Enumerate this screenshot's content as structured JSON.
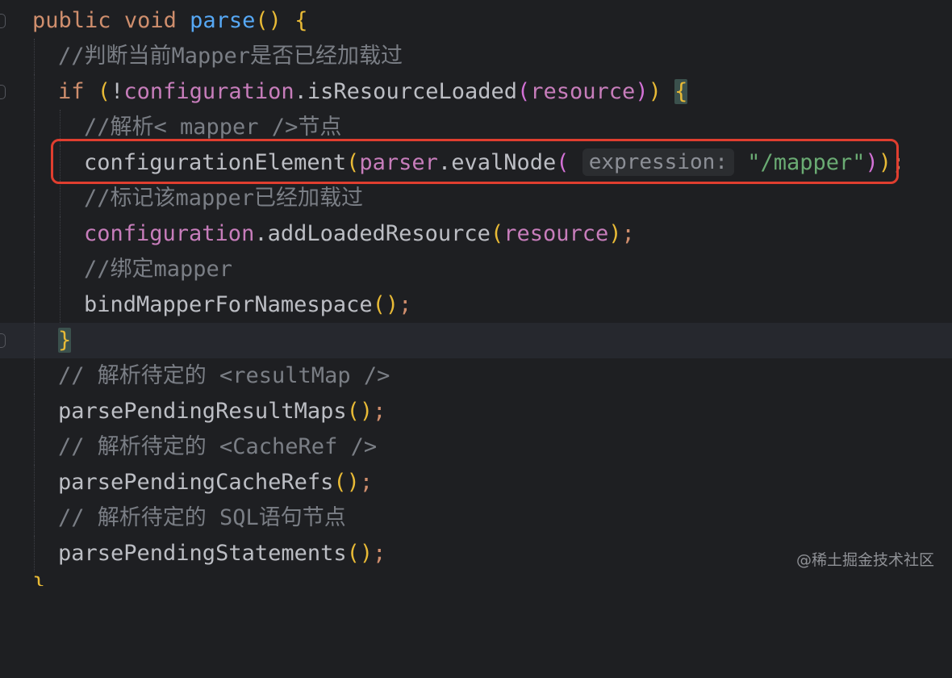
{
  "code": {
    "line1": {
      "kw1": "public",
      "kw2": "void",
      "fn": "parse",
      "open": "(",
      "close": ")",
      "brace": "{"
    },
    "line2": {
      "comment": "//判断当前Mapper是否已经加载过"
    },
    "line3": {
      "kw": "if",
      "open": "(",
      "bang": "!",
      "obj": "configuration",
      "dot": ".",
      "method": "isResourceLoaded",
      "popen": "(",
      "arg": "resource",
      "pclose": ")",
      "close": ")",
      "brace": "{"
    },
    "line4": {
      "comment": "//解析< mapper />节点"
    },
    "line5": {
      "method": "configurationElement",
      "popen": "(",
      "obj": "parser",
      "dot": ".",
      "inner": "evalNode",
      "iopen": "(",
      "hint": "expression:",
      "str": "\"/mapper\"",
      "iclose": ")",
      "pclose": ")",
      "semi": ";"
    },
    "line6": {
      "comment": "//标记该mapper已经加载过"
    },
    "line7": {
      "obj": "configuration",
      "dot": ".",
      "method": "addLoadedResource",
      "popen": "(",
      "arg": "resource",
      "pclose": ")",
      "semi": ";"
    },
    "line8": {
      "comment": "//绑定mapper"
    },
    "line9": {
      "method": "bindMapperForNamespace",
      "popen": "(",
      "pclose": ")",
      "semi": ";"
    },
    "line10": {
      "brace": "}"
    },
    "line11": {
      "comment": "// 解析待定的 <resultMap />"
    },
    "line12": {
      "method": "parsePendingResultMaps",
      "popen": "(",
      "pclose": ")",
      "semi": ";"
    },
    "line13": {
      "comment": "// 解析待定的 <CacheRef />"
    },
    "line14": {
      "method": "parsePendingCacheRefs",
      "popen": "(",
      "pclose": ")",
      "semi": ";"
    },
    "line15": {
      "comment": "// 解析待定的 SQL语句节点"
    },
    "line16": {
      "method": "parsePendingStatements",
      "popen": "(",
      "pclose": ")",
      "semi": ";"
    },
    "line17": {
      "brace": "}"
    }
  },
  "watermark": "@稀土掘金技术社区",
  "colors": {
    "background": "#1e1f22",
    "keyword": "#cf8e6d",
    "method_declaration": "#56a8f5",
    "field": "#c77dbb",
    "string": "#6aab73",
    "comment": "#7a7e85",
    "highlight_box": "#e03e2f"
  }
}
